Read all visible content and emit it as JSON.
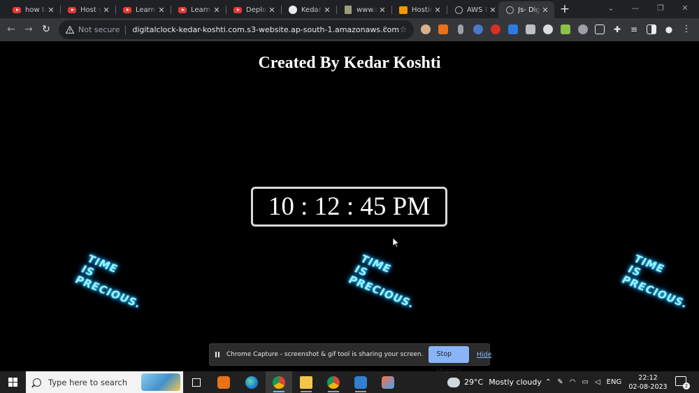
{
  "browser": {
    "tabs": [
      {
        "label": "how to",
        "favicon": "youtube-icon"
      },
      {
        "label": "Host y",
        "favicon": "youtube-icon"
      },
      {
        "label": "Learn",
        "favicon": "youtube-icon"
      },
      {
        "label": "Learn",
        "favicon": "youtube-icon"
      },
      {
        "label": "Deploy",
        "favicon": "youtube-icon"
      },
      {
        "label": "Kedark",
        "favicon": "github-icon"
      },
      {
        "label": "www.d",
        "favicon": "page-icon"
      },
      {
        "label": "Hostin",
        "favicon": "hosting-icon"
      },
      {
        "label": "AWS P",
        "favicon": "globe-icon"
      },
      {
        "label": "Js- Dig",
        "favicon": "globe-icon",
        "active": true
      }
    ],
    "new_tab": "+",
    "security_label": "Not secure",
    "url": "digitalclock-kedar-koshti.com.s3-website.ap-south-1.amazonaws.com"
  },
  "page": {
    "heading": "Created By Kedar Koshti",
    "clock": "10 : 12 : 45 PM",
    "gif_text": "TIME\nIS\nPRECIOUS."
  },
  "share_bar": {
    "message": "Chrome Capture - screenshot & gif tool is sharing your screen.",
    "stop_label": "Stop sharing",
    "hide_label": "Hide"
  },
  "taskbar": {
    "search_placeholder": "Type here to search",
    "weather_temp": "29°C",
    "weather_desc": "Mostly cloudy",
    "language": "ENG",
    "time": "22:12",
    "date": "02-08-2023",
    "notification_count": "2"
  },
  "colors": {
    "accent": "#8ab4f8",
    "neon": "#9ff3ff"
  }
}
